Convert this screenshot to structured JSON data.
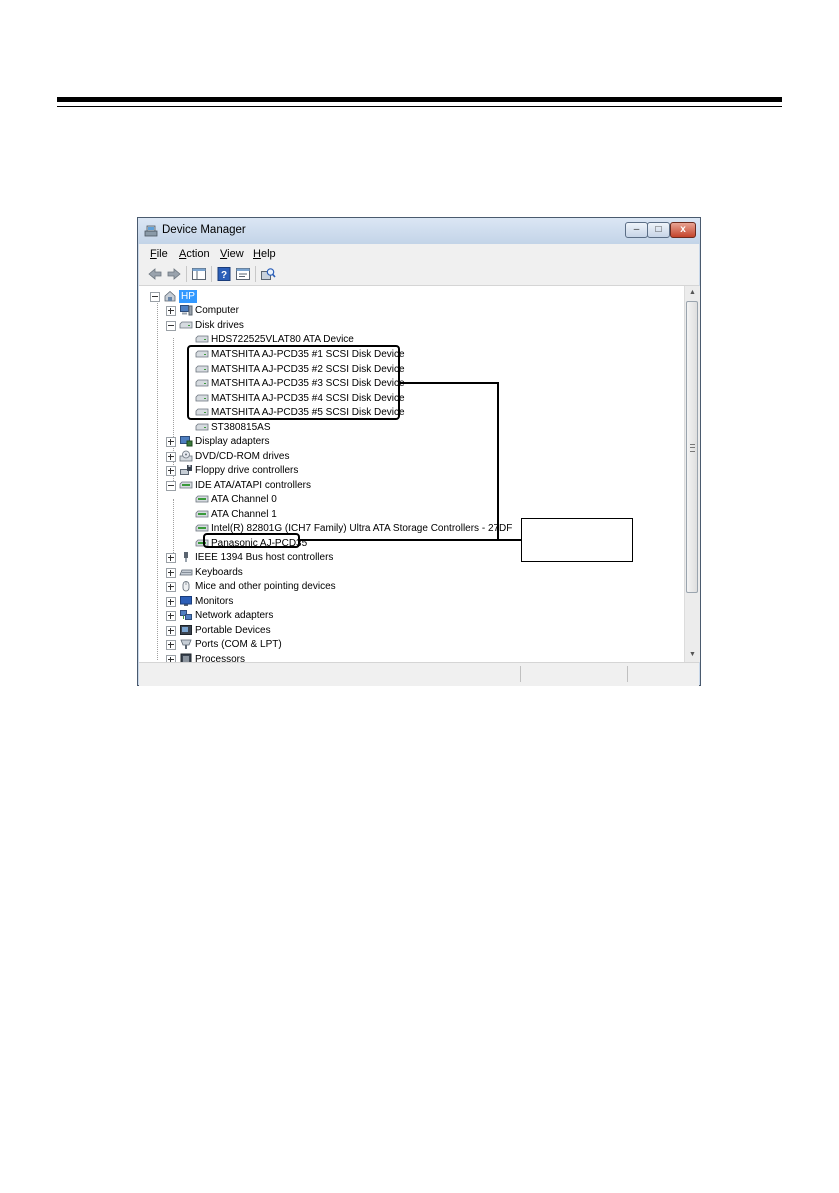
{
  "window": {
    "title": "Device Manager",
    "min_label": "–",
    "max_label": "□",
    "close_label": "x"
  },
  "menu": [
    "File",
    "Action",
    "View",
    "Help"
  ],
  "toolbar": {
    "buttons": [
      "back-icon",
      "forward-icon",
      "show-hide-tree-icon",
      "help-icon",
      "properties-icon",
      "scan-hardware-icon"
    ]
  },
  "tree": {
    "root": "HP",
    "items": [
      {
        "label": "Computer",
        "icon": "computer-icon"
      },
      {
        "label": "Disk drives",
        "icon": "disk-drive-icon"
      },
      {
        "label": "HDS722525VLAT80 ATA Device",
        "icon": "disk-drive-icon"
      },
      {
        "label": "MATSHITA AJ-PCD35  #1 SCSI Disk Device",
        "icon": "disk-drive-icon"
      },
      {
        "label": "MATSHITA AJ-PCD35  #2 SCSI Disk Device",
        "icon": "disk-drive-icon"
      },
      {
        "label": "MATSHITA AJ-PCD35  #3 SCSI Disk Device",
        "icon": "disk-drive-icon"
      },
      {
        "label": "MATSHITA AJ-PCD35  #4 SCSI Disk Device",
        "icon": "disk-drive-icon"
      },
      {
        "label": "MATSHITA AJ-PCD35  #5 SCSI Disk Device",
        "icon": "disk-drive-icon"
      },
      {
        "label": "ST380815AS",
        "icon": "disk-drive-icon"
      },
      {
        "label": "Display adapters",
        "icon": "display-adapter-icon"
      },
      {
        "label": "DVD/CD-ROM drives",
        "icon": "dvd-drive-icon"
      },
      {
        "label": "Floppy drive controllers",
        "icon": "floppy-controller-icon"
      },
      {
        "label": "IDE ATA/ATAPI controllers",
        "icon": "ide-controller-icon"
      },
      {
        "label": "ATA Channel 0",
        "icon": "ide-controller-icon"
      },
      {
        "label": "ATA Channel 1",
        "icon": "ide-controller-icon"
      },
      {
        "label": "Intel(R) 82801G (ICH7 Family) Ultra ATA Storage Controllers - 27DF",
        "icon": "ide-controller-icon"
      },
      {
        "label": "Panasonic AJ-PCD35",
        "icon": "ide-controller-icon"
      },
      {
        "label": "IEEE 1394 Bus host controllers",
        "icon": "firewire-icon"
      },
      {
        "label": "Keyboards",
        "icon": "keyboard-icon"
      },
      {
        "label": "Mice and other pointing devices",
        "icon": "mouse-icon"
      },
      {
        "label": "Monitors",
        "icon": "monitor-icon"
      },
      {
        "label": "Network adapters",
        "icon": "network-adapter-icon"
      },
      {
        "label": "Portable Devices",
        "icon": "portable-device-icon"
      },
      {
        "label": "Ports (COM & LPT)",
        "icon": "port-icon"
      },
      {
        "label": "Processors",
        "icon": "processor-icon"
      }
    ]
  },
  "colors": {
    "title_gradient_top": "#dbe6f4",
    "close_button": "#c4442b",
    "selection": "#3399ff"
  }
}
